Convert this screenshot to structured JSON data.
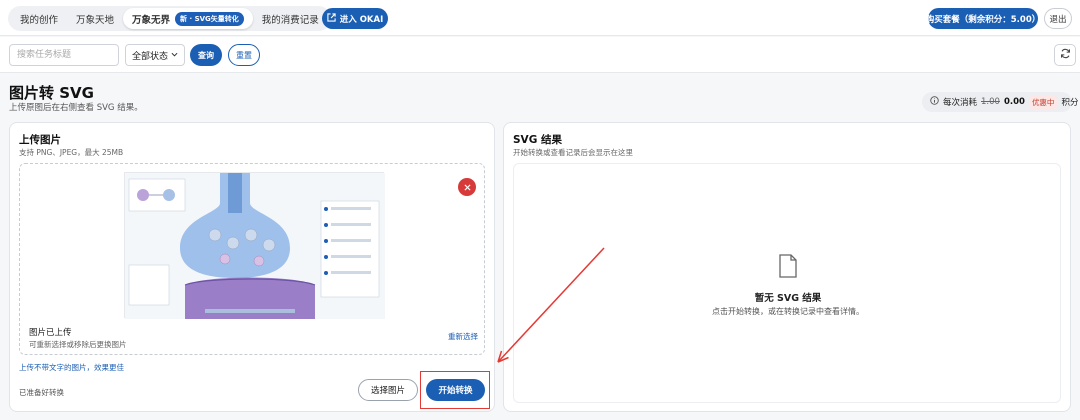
{
  "topbar": {
    "tabs": [
      {
        "label": "我的创作"
      },
      {
        "label": "万象天地"
      },
      {
        "label": "万象无界",
        "badge": "新 · SVG矢量转化",
        "active": true
      },
      {
        "label": "我的消费记录"
      }
    ],
    "okai_label": "进入 OKAI",
    "buy_label": "购买套餐（剩余积分：5.00）",
    "logout_label": "退出"
  },
  "filters": {
    "search_placeholder": "搜索任务标题",
    "status_selected": "全部状态",
    "query_label": "查询",
    "reset_label": "重置"
  },
  "page": {
    "title": "图片转 SVG",
    "subtitle": "上传原图后在右侧查看 SVG 结果。"
  },
  "cost": {
    "prefix": "每次消耗",
    "old_price": "1.00",
    "new_price": "0.00",
    "tag": "优惠中",
    "unit": "积分"
  },
  "upload_panel": {
    "title": "上传图片",
    "subtitle": "支持 PNG、JPEG，最大 25MB",
    "uploaded_label": "图片已上传",
    "uploaded_hint": "可重新选择或移除后更换图片",
    "reselect_label": "重新选择",
    "tip": "上传不带文字的图片，效果更佳",
    "status": "已准备好转换",
    "choose_label": "选择图片",
    "convert_label": "开始转换"
  },
  "result_panel": {
    "title": "SVG 结果",
    "subtitle": "开始转换或查看记录后会显示在这里",
    "empty_title": "暂无 SVG 结果",
    "empty_hint": "点击开始转换，或在转换记录中查看详情。"
  },
  "colors": {
    "primary": "#1b5fb4",
    "danger": "#d63a3a",
    "annotation": "#e53935"
  },
  "icons": {
    "okai": "external-link-icon",
    "refresh": "refresh-icon",
    "info": "info-icon",
    "remove": "close-icon",
    "empty": "file-icon"
  }
}
